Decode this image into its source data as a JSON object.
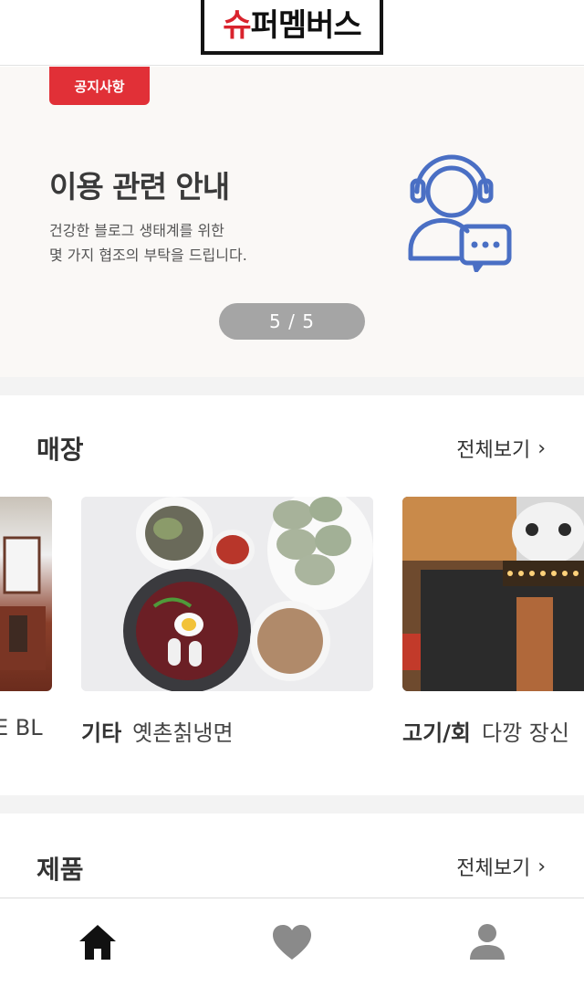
{
  "header": {
    "logo_text_red": "슈",
    "logo_text_black": "퍼멤버스"
  },
  "banner": {
    "badge": "공지사항",
    "title": "이용 관련 안내",
    "description": "건강한 블로그 생태계를 위한\n몇 가지 협조의 부탁을 드립니다.",
    "pager": "5 / 5",
    "icon": "customer-support-icon"
  },
  "stores": {
    "title": "매장",
    "see_all": "전체보기",
    "items": [
      {
        "category": "",
        "name": "E BL"
      },
      {
        "category": "기타",
        "name": "옛촌칡냉면"
      },
      {
        "category": "고기/회",
        "name": "다깡 장신"
      }
    ]
  },
  "products": {
    "title": "제품",
    "see_all": "전체보기"
  },
  "nav": {
    "items": [
      "home-icon",
      "heart-icon",
      "user-icon"
    ],
    "active_color": "#111111",
    "inactive_color": "#8a8a8a"
  },
  "colors": {
    "accent": "#e13037",
    "banner_bg": "#faf8f6",
    "icon_blue": "#4a6fc4"
  }
}
